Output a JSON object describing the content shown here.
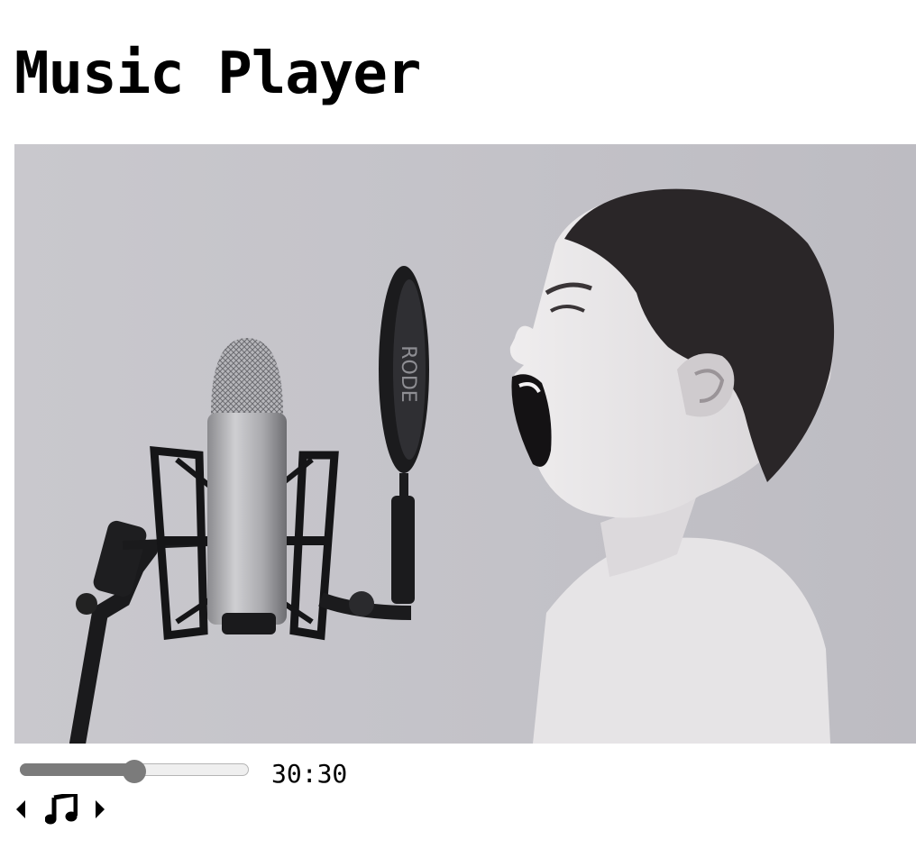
{
  "page": {
    "title": "Music Player"
  },
  "artwork": {
    "description_icon": "album-artwork-image",
    "pop_filter_text": "RODE"
  },
  "player": {
    "progress_fraction": 0.5,
    "time_display": "30:30",
    "controls": {
      "prev_icon": "caret-left-icon",
      "play_icon": "music-note-icon",
      "next_icon": "caret-right-icon"
    }
  },
  "colors": {
    "text": "#000000",
    "slider_fill": "#7b7b7b",
    "slider_track": "#efefef",
    "artwork_background": "#c4c3c8"
  }
}
